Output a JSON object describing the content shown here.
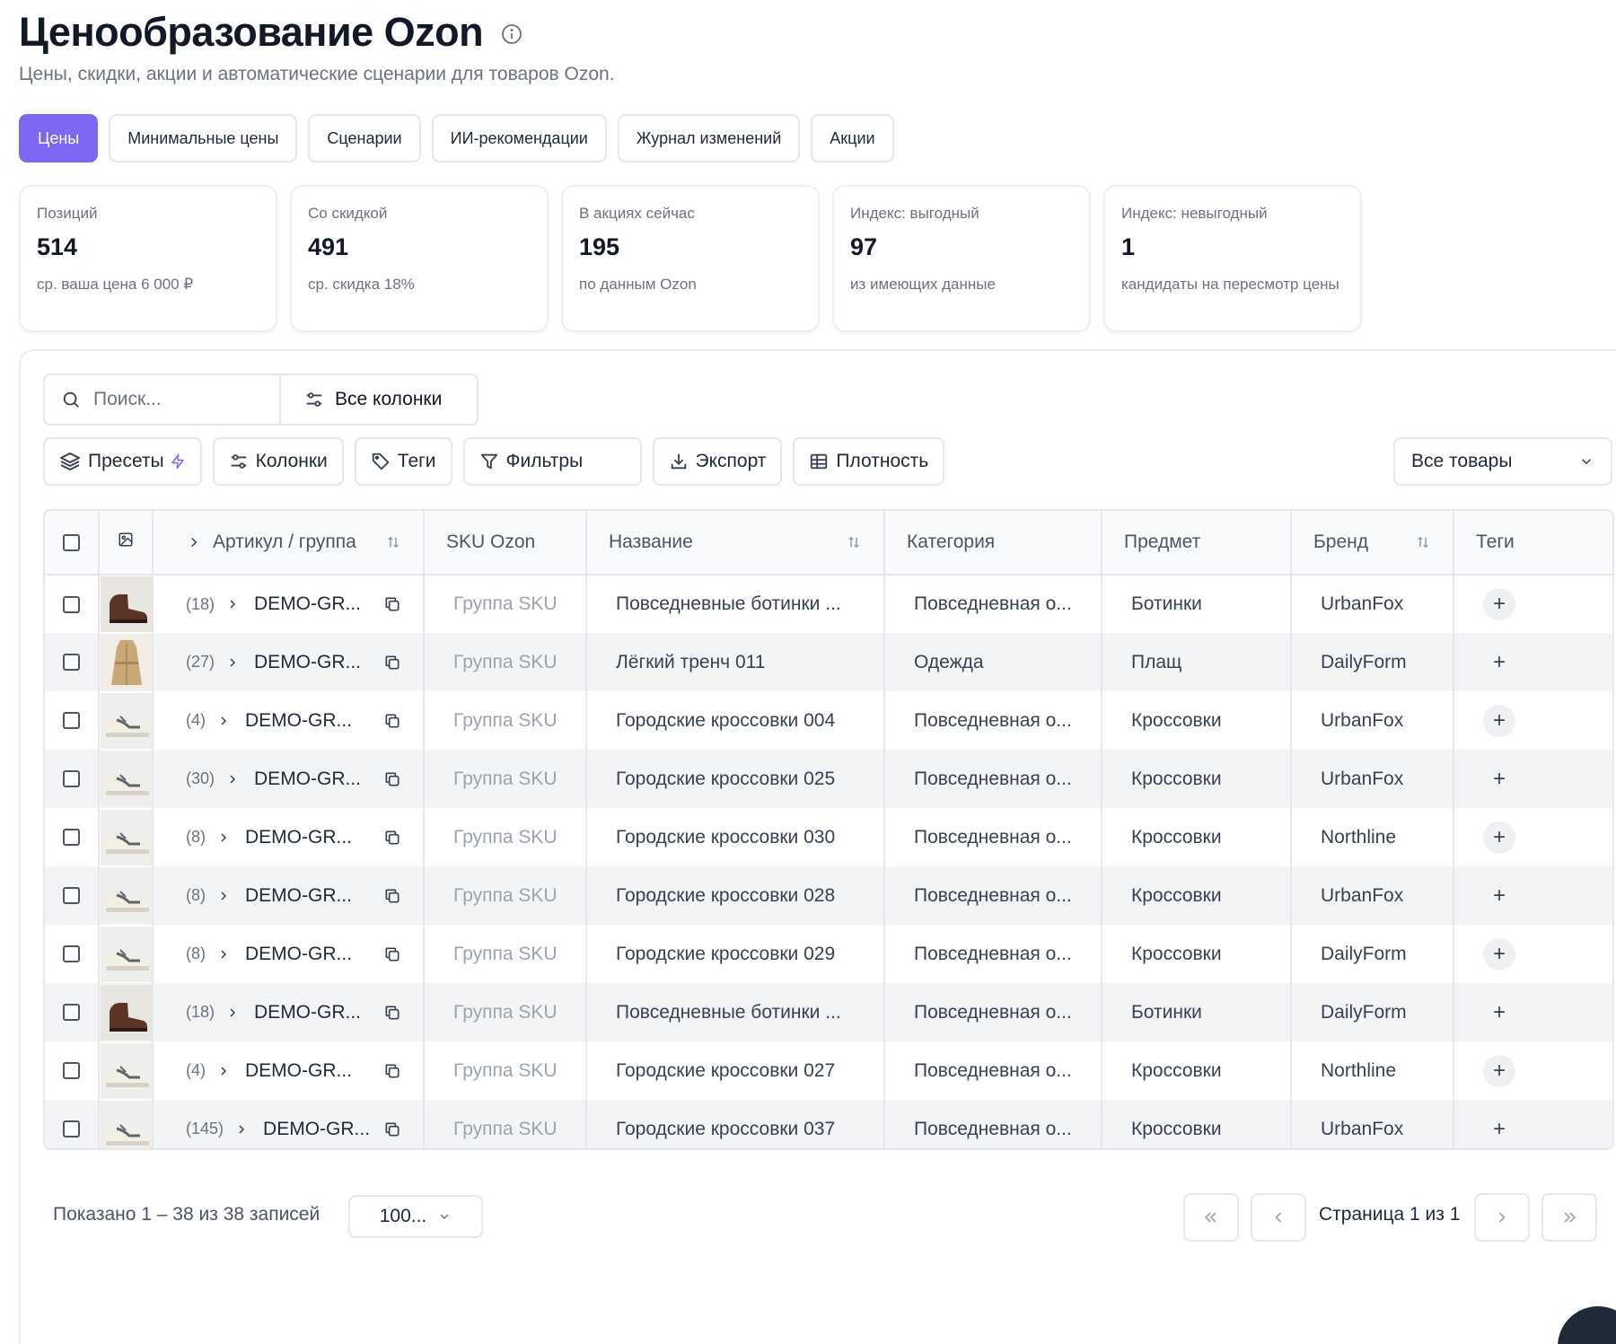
{
  "header": {
    "title": "Ценообразование Ozon",
    "subtitle": "Цены, скидки, акции и автоматические сценарии для товаров Ozon."
  },
  "tabs": [
    {
      "label": "Цены",
      "active": true
    },
    {
      "label": "Минимальные цены",
      "active": false
    },
    {
      "label": "Сценарии",
      "active": false
    },
    {
      "label": "ИИ-рекомендации",
      "active": false
    },
    {
      "label": "Журнал изменений",
      "active": false
    },
    {
      "label": "Акции",
      "active": false
    }
  ],
  "stats": [
    {
      "label": "Позиций",
      "value": "514",
      "note": "ср. ваша цена 6 000 ₽"
    },
    {
      "label": "Со скидкой",
      "value": "491",
      "note": "ср. скидка 18%"
    },
    {
      "label": "В акциях сейчас",
      "value": "195",
      "note": "по данным Ozon"
    },
    {
      "label": "Индекс: выгодный",
      "value": "97",
      "note": "из имеющих данные"
    },
    {
      "label": "Индекс: невыгодный",
      "value": "1",
      "note": "кандидаты на пересмотр цены"
    }
  ],
  "search": {
    "placeholder": "Поиск...",
    "all_columns_label": "Все колонки"
  },
  "toolbar": {
    "presets": "Пресеты",
    "columns": "Колонки",
    "tags": "Теги",
    "filters": "Фильтры",
    "export": "Экспорт",
    "density": "Плотность",
    "scope_select": "Все товары"
  },
  "table": {
    "headers": {
      "article": "Артикул / группа",
      "sku": "SKU Ozon",
      "name": "Название",
      "category": "Категория",
      "subject": "Предмет",
      "brand": "Бренд",
      "tags": "Теги"
    },
    "rows": [
      {
        "count": "(18)",
        "code": "DEMO-GR...",
        "sku": "Группа SKU",
        "name": "Повседневные ботинки ...",
        "category": "Повседневная о...",
        "subject": "Ботинки",
        "brand": "UrbanFox",
        "thumb": "boot"
      },
      {
        "count": "(27)",
        "code": "DEMO-GR...",
        "sku": "Группа SKU",
        "name": "Лёгкий тренч 011",
        "category": "Одежда",
        "subject": "Плащ",
        "brand": "DailyForm",
        "thumb": "coat"
      },
      {
        "count": "(4)",
        "code": "DEMO-GR...",
        "sku": "Группа SKU",
        "name": "Городские кроссовки 004",
        "category": "Повседневная о...",
        "subject": "Кроссовки",
        "brand": "UrbanFox",
        "thumb": "sneaker"
      },
      {
        "count": "(30)",
        "code": "DEMO-GR...",
        "sku": "Группа SKU",
        "name": "Городские кроссовки 025",
        "category": "Повседневная о...",
        "subject": "Кроссовки",
        "brand": "UrbanFox",
        "thumb": "sneaker"
      },
      {
        "count": "(8)",
        "code": "DEMO-GR...",
        "sku": "Группа SKU",
        "name": "Городские кроссовки 030",
        "category": "Повседневная о...",
        "subject": "Кроссовки",
        "brand": "Northline",
        "thumb": "sneaker"
      },
      {
        "count": "(8)",
        "code": "DEMO-GR...",
        "sku": "Группа SKU",
        "name": "Городские кроссовки 028",
        "category": "Повседневная о...",
        "subject": "Кроссовки",
        "brand": "UrbanFox",
        "thumb": "sneaker"
      },
      {
        "count": "(8)",
        "code": "DEMO-GR...",
        "sku": "Группа SKU",
        "name": "Городские кроссовки 029",
        "category": "Повседневная о...",
        "subject": "Кроссовки",
        "brand": "DailyForm",
        "thumb": "sneaker"
      },
      {
        "count": "(18)",
        "code": "DEMO-GR...",
        "sku": "Группа SKU",
        "name": "Повседневные ботинки ...",
        "category": "Повседневная о...",
        "subject": "Ботинки",
        "brand": "DailyForm",
        "thumb": "boot"
      },
      {
        "count": "(4)",
        "code": "DEMO-GR...",
        "sku": "Группа SKU",
        "name": "Городские кроссовки 027",
        "category": "Повседневная о...",
        "subject": "Кроссовки",
        "brand": "Northline",
        "thumb": "sneaker"
      },
      {
        "count": "(145)",
        "code": "DEMO-GR...",
        "sku": "Группа SKU",
        "name": "Городские кроссовки 037",
        "category": "Повседневная о...",
        "subject": "Кроссовки",
        "brand": "UrbanFox",
        "thumb": "sneaker"
      }
    ]
  },
  "footer": {
    "count_text": "Показано 1 – 38 из 38 записей",
    "page_size": "100...",
    "page_label": "Страница 1 из 1"
  },
  "colors": {
    "accent": "#7c68f2",
    "border": "#e5e7eb",
    "muted": "#9ca3af"
  },
  "icons": [
    "info-icon",
    "search-icon",
    "sliders-icon",
    "layers-icon",
    "bolt-icon",
    "tag-icon",
    "filter-icon",
    "download-icon",
    "table-icon",
    "chevron-down-icon",
    "image-icon",
    "chevron-right-icon",
    "sort-icon",
    "copy-icon",
    "plus-icon",
    "chevrons-left-icon",
    "chevron-left-icon",
    "chevrons-right-icon"
  ]
}
